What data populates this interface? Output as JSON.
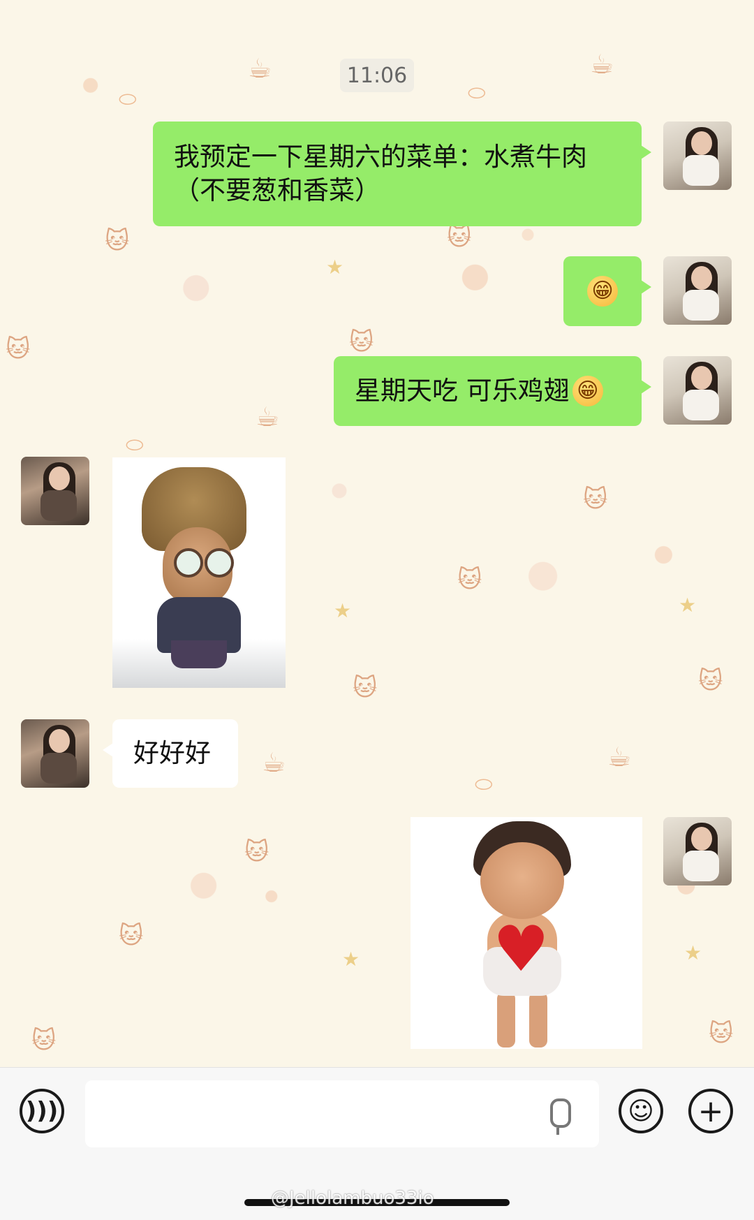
{
  "chat": {
    "time": "11:06",
    "messages": [
      {
        "from": "me",
        "type": "text",
        "text": "我预定一下星期六的菜单：水煮牛肉（不要葱和香菜）"
      },
      {
        "from": "me",
        "type": "emoji",
        "emoji": "😁"
      },
      {
        "from": "me",
        "type": "text",
        "text": "星期天吃 可乐鸡翅",
        "emoji": "😁"
      },
      {
        "from": "her",
        "type": "sticker",
        "sticker": "bear-hat-man-sticker"
      },
      {
        "from": "her",
        "type": "text",
        "text": "好好好"
      },
      {
        "from": "me",
        "type": "sticker",
        "sticker": "heart-boy-sticker"
      }
    ]
  },
  "input_bar": {
    "voice_icon": "voice-mode-icon",
    "mic_icon": "microphone-icon",
    "emoji_icon": "smiley-icon",
    "plus_icon": "plus-icon"
  },
  "watermark": "@Jellolambuo33io",
  "colors": {
    "sent_bubble": "#95ec69",
    "received_bubble": "#ffffff",
    "wallpaper": "#fbf6e8"
  }
}
